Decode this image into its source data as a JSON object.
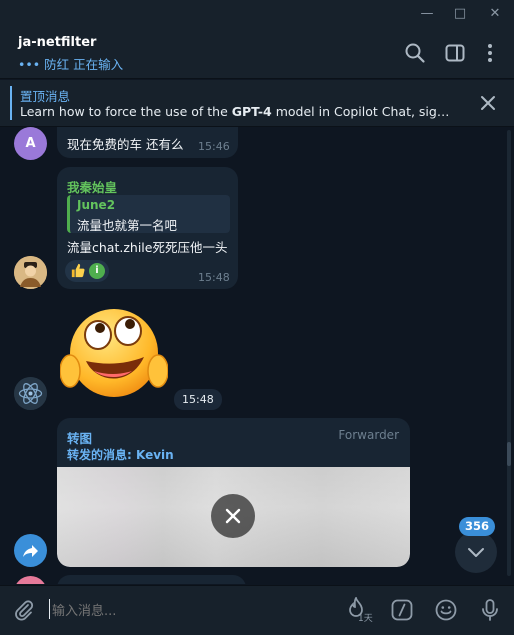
{
  "window": {
    "minimize": "—",
    "maximize": "□",
    "close": "✕"
  },
  "header": {
    "title": "ja-netfilter",
    "status": "••• 防红 正在输入",
    "icons": [
      "search-icon",
      "sidebar-toggle-icon",
      "more-vertical-icon"
    ]
  },
  "pinned": {
    "title": "置顶消息",
    "text_before": "Learn how to force the use of the ",
    "text_bold": "GPT-4",
    "text_after": " model in Copilot Chat, significa..."
  },
  "messages": [
    {
      "avatar_letter": "A",
      "text": "现在免费的车 还有么",
      "time": "15:46",
      "avatar_color": "#9a79d9"
    },
    {
      "sender": "我秦始皇",
      "sender_color": "#63c35d",
      "quote_author": "June2",
      "quote_text": "流量也就第一名吧",
      "text": "流量chat.zhile死死压他一头",
      "reaction_letter": "i",
      "time": "15:48"
    },
    {
      "sticker": "face-with-rolling-eyes-sticker",
      "time": "15:48"
    },
    {
      "title": "转图",
      "via": "Forwarder",
      "forward_label": "转发的消息:",
      "forward_from": "Kevin"
    }
  ],
  "scroll": {
    "unread_count": "356"
  },
  "composer": {
    "placeholder": "输入消息...",
    "timer_label": "1天"
  },
  "colors": {
    "accent": "#6ab3f3",
    "background": "#0e1621",
    "bubble": "#182533",
    "panel": "#17212b"
  }
}
